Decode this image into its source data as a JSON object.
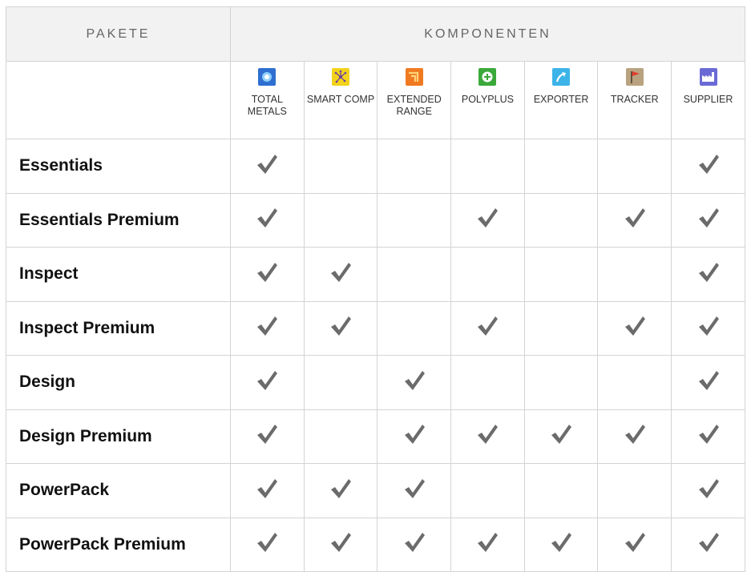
{
  "header": {
    "packages_label": "PAKETE",
    "components_label": "KOMPONENTEN"
  },
  "components": [
    {
      "id": "total-metals",
      "label": "TOTAL METALS",
      "icon": "total-metals-icon",
      "color": "#2f6fd1"
    },
    {
      "id": "smart-comp",
      "label": "SMART COMP",
      "icon": "smart-comp-icon",
      "color": "#f2d21b"
    },
    {
      "id": "extended-range",
      "label": "EXTENDED RANGE",
      "icon": "extended-range-icon",
      "color": "#f07a21"
    },
    {
      "id": "polyplus",
      "label": "POLYPLUS",
      "icon": "polyplus-icon",
      "color": "#3aa93a"
    },
    {
      "id": "exporter",
      "label": "EXPORTER",
      "icon": "exporter-icon",
      "color": "#3db4e8"
    },
    {
      "id": "tracker",
      "label": "TRACKER",
      "icon": "tracker-icon",
      "color": "#b9a27f"
    },
    {
      "id": "supplier",
      "label": "SUPPLIER",
      "icon": "supplier-icon",
      "color": "#6a6ad6"
    }
  ],
  "packages": [
    {
      "name": "Essentials",
      "checks": [
        true,
        false,
        false,
        false,
        false,
        false,
        true
      ]
    },
    {
      "name": "Essentials Premium",
      "checks": [
        true,
        false,
        false,
        true,
        false,
        true,
        true
      ]
    },
    {
      "name": "Inspect",
      "checks": [
        true,
        true,
        false,
        false,
        false,
        false,
        true
      ]
    },
    {
      "name": "Inspect Premium",
      "checks": [
        true,
        true,
        false,
        true,
        false,
        true,
        true
      ]
    },
    {
      "name": "Design",
      "checks": [
        true,
        false,
        true,
        false,
        false,
        false,
        true
      ]
    },
    {
      "name": "Design Premium",
      "checks": [
        true,
        false,
        true,
        true,
        true,
        true,
        true
      ]
    },
    {
      "name": "PowerPack",
      "checks": [
        true,
        true,
        true,
        false,
        false,
        false,
        true
      ]
    },
    {
      "name": "PowerPack Premium",
      "checks": [
        true,
        true,
        true,
        true,
        true,
        true,
        true
      ]
    }
  ],
  "colors": {
    "check": "#6b6b6b",
    "header_bg": "#f2f2f2",
    "border": "#d4d4d4"
  }
}
